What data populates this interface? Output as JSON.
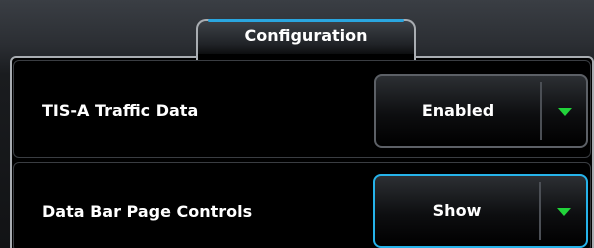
{
  "tab": {
    "label": "Configuration"
  },
  "rows": [
    {
      "label": "TIS-A Traffic Data",
      "value": "Enabled"
    },
    {
      "label": "Data Bar Page Controls",
      "value": "Show"
    }
  ],
  "colors": {
    "selected_border": "#26b3ea",
    "tab_accent": "#2aa6e0",
    "dropdown_arrow": "#21d33a"
  },
  "icons": {
    "dropdown": "triangle-down-icon"
  }
}
